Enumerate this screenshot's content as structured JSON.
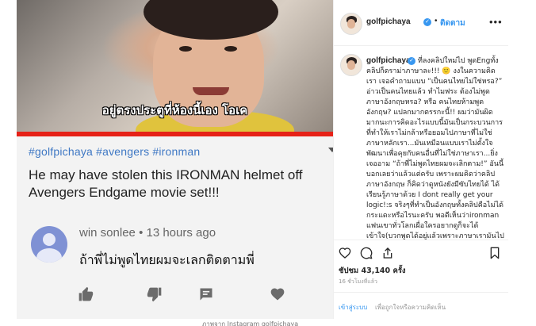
{
  "media": {
    "video_caption": "อยู่ตรงประตูที่ห้องนี้เอง โอเค",
    "video_progress_percent": 100,
    "hashtags": "#golfpichaya #avengers #ironman",
    "video_title": "He may have stolen this IRONMAN helmet off Avengers Endgame movie set!!!",
    "comment_author": "win sonlee",
    "comment_time": "13 hours ago",
    "comment_text": "ถ้าพี่ไม่พูดไทยผมจะเลกติดตามพี่",
    "icons": [
      "like-icon",
      "dislike-icon",
      "reply-icon",
      "heart-icon"
    ]
  },
  "post": {
    "username": "golfpichaya",
    "dot": "•",
    "follow_label": "ติดตาม",
    "options_label": "•••",
    "caption": "ที่ลงคลิปใหม่ไป พูดEngทั้งคลิปก็ดราม่าภาษาละ!!! 🙂 งงในความคิดเรา เจอคำถามแบบ “เป็นคนไทยไม่ใช่หรอ?” อ่าวเป็นคนไทยแล้ว ทำไมฟระ ต้องไม่พูดภาษาอังกฤษหรอ? หรือ คนไทยห้ามพูดอังกฤษ? แปลกมากตรรกะนี้!! ผมว่ามันผิดมากนะการคิดอะไรแบบนี้มันเป็นกระบวนการที่ทำให้เราไม่กล้าหรือยอมไปภาษาที่ไม่ใช่ภาษาหลักเรา...มันเหมือนแบบเราไม่ตั้งใจพัฒนาเพื่อคุยกับคนอื่นที่ไม่ใช่ภาษาเรา...ยิ่งเจออาม “ถ้าพี่ไม่พูดไทยผมจะเลิกตาม!” อันนี้บอกเลยว่าแล้วแต่ครับ เพราะผมคิดว่าคลิปภาษาอังกฤษ ก็คิดว่าดูหนังยังมีซับไทยได้ ได้เรียนรู้ภาษาด้วย I dont really get your logic!:s จริงๆที่ทำเป็นอังกฤษทั้งคลิปคือไม่ได้กระแดะหรือไรนะครับ พอดีเห็นว่าironman แฟนเขาทั่วโลกเผื่อใครอยากดูก็จะได้เข้าใจ(บวกพูดได้อยู่แล้วเพราะภาษาเรามันไปได้global เข้าใจ",
    "likes": "ชัปชม 43,140 ครั้ง",
    "time_ago": "16 ชั่วโมงที่แล้ว",
    "login_link": "เข้าสู่ระบบ",
    "login_text": "เพื่อถูกใจหรือความคิดเห็น",
    "icons": [
      "heart-outline-icon",
      "comment-icon",
      "share-icon",
      "bookmark-icon"
    ],
    "verified_color": "#3897f0",
    "link_color": "#3897f0"
  },
  "credit": "ภาพจาก Instagram golfpichaya"
}
